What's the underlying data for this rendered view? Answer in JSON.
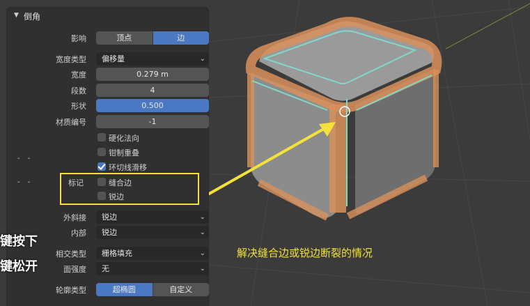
{
  "panel": {
    "title": "倒角",
    "affect": {
      "label": "影响",
      "options": [
        "顶点",
        "边"
      ],
      "selected": "边"
    },
    "width_type": {
      "label": "宽度类型",
      "value": "偏移量"
    },
    "width": {
      "label": "宽度",
      "value": "0.279 m"
    },
    "segments": {
      "label": "段数",
      "value": "4"
    },
    "shape": {
      "label": "形状",
      "value": "0.500"
    },
    "material": {
      "label": "材质编号",
      "value": "-1"
    },
    "checkboxes": [
      {
        "label": "硬化法向",
        "checked": false
      },
      {
        "label": "钳制重叠",
        "checked": false
      },
      {
        "label": "环切线滑移",
        "checked": true
      }
    ],
    "mark": {
      "label": "标记",
      "seam": "缝合边",
      "sharp": "锐边"
    },
    "outer_miter": {
      "label": "外斜接",
      "value": "锐边"
    },
    "inner_miter": {
      "label": "内部",
      "value": "锐边"
    },
    "intersection": {
      "label": "相交类型",
      "value": "栅格填充"
    },
    "face_strength": {
      "label": "面强度",
      "value": "无"
    },
    "profile": {
      "label": "轮廓类型",
      "options": [
        "超椭圆",
        "自定义"
      ],
      "selected": "超椭圆"
    }
  },
  "dashes": [
    "- -",
    "- -"
  ],
  "overlay": {
    "line1": "键按下",
    "line2": "键松开"
  },
  "annotation": "解决缝合边或锐边断裂的情况",
  "colors": {
    "accent": "#4a78c2",
    "highlight": "#f5e13a",
    "mesh": "#d9915c"
  }
}
